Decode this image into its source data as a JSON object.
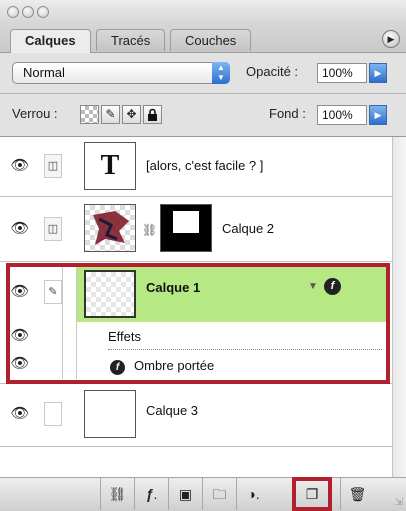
{
  "window": {
    "traffic_lights": [
      "close-dot",
      "minimize-dot",
      "zoom-dot"
    ]
  },
  "tabs": [
    {
      "label": "Calques",
      "active": true
    },
    {
      "label": "Tracés",
      "active": false
    },
    {
      "label": "Couches",
      "active": false
    }
  ],
  "panel_menu_icon": "panel-menu-arrow-icon",
  "blend": {
    "mode": "Normal",
    "opacity_label": "Opacité :",
    "opacity_value": "100%"
  },
  "lock": {
    "label": "Verrou :",
    "icons": [
      "lock-transparency-icon",
      "lock-paint-icon",
      "lock-move-icon",
      "lock-all-icon"
    ],
    "fill_label": "Fond :",
    "fill_value": "100%"
  },
  "layers": [
    {
      "name": "[alors, c'est facile ? ]",
      "kind": "text",
      "thumb_glyph": "T",
      "visible": true,
      "linked": true
    },
    {
      "name": "Calque 2",
      "kind": "masked",
      "visible": true,
      "linked": true
    },
    {
      "name": "Calque 1",
      "kind": "normal",
      "visible": true,
      "selected": true,
      "effects_label": "Effets",
      "effect": "Ombre portée"
    },
    {
      "name": "Calque 3",
      "kind": "normal",
      "visible": true,
      "linked": false
    }
  ],
  "bottom_buttons": [
    "link-layers-icon",
    "layer-style-icon",
    "layer-mask-icon",
    "new-group-icon",
    "adjustment-layer-icon",
    "new-layer-icon",
    "trash-icon"
  ],
  "colors": {
    "selected_row": "#b6e884",
    "highlight_red": "#b0202e",
    "accent_blue": "#2d6fd0"
  }
}
